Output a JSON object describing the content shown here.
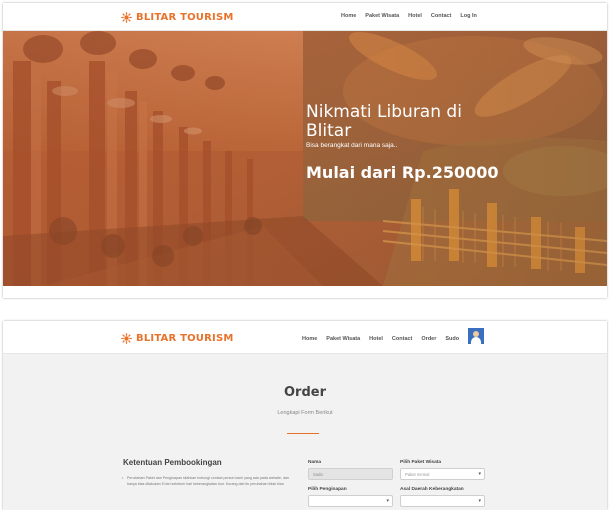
{
  "brand": {
    "name": "BLITAR TOURISM",
    "accent_color": "#e8722a",
    "icon": "sun-logo-icon"
  },
  "screen1": {
    "nav": [
      "Home",
      "Paket Wisata",
      "Hotel",
      "Contact",
      "Log In"
    ],
    "hero": {
      "title": "Nikmati Liburan di Blitar",
      "subtitle": "Bisa berangkat dari mana saja..",
      "price": "Mulai dari Rp.250000"
    }
  },
  "screen2": {
    "nav": [
      "Home",
      "Paket Wisata",
      "Hotel",
      "Contact",
      "Order",
      "Sudo"
    ],
    "avatar_icon": "user-avatar-icon",
    "order": {
      "title": "Order",
      "subtitle": "Lengkapi Form Berikut"
    },
    "terms": {
      "title": "Ketentuan Pembookingan",
      "items": [
        "Perubahan Paket dan Penginapan silahkan hubungi contact person kami yang ada pada website, dan hanya bisa dilakukan 5 hari sebelum hari keberangkatan tour. Kurang dari itu perubahan tidak bisa"
      ]
    },
    "form": {
      "name_label": "Nama",
      "name_value": "Sudo",
      "paket_label": "Pilih Paket Wisata",
      "paket_value": "Paket memal",
      "penginapan_label": "Pilih Penginapan",
      "asal_label": "Asal Daerah Keberangkatan"
    }
  }
}
